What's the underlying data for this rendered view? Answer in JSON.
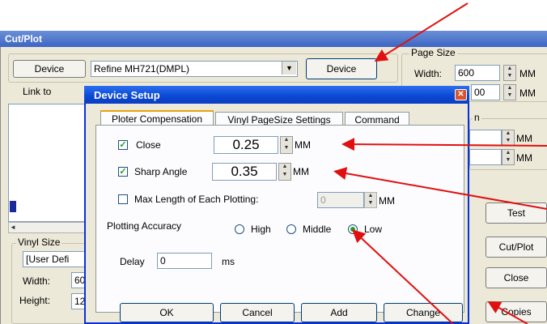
{
  "main_window": {
    "title": "Cut/Plot",
    "device_button": "Device",
    "device_select": "Refine MH721(DMPL)",
    "device_button_2": "Device",
    "link_to_label": "Link to",
    "page_size": {
      "label": "Page Size",
      "width_label": "Width:",
      "width_value": "600",
      "height_value": "00",
      "unit": "MM"
    },
    "right_group": {
      "label": "n",
      "unit_1": "MM",
      "unit_2": "MM"
    },
    "vinyl_size": {
      "label": "Vinyl Size",
      "select_value": "[User Defi",
      "width_label": "Width:",
      "width_value": "60",
      "height_label": "Height:",
      "height_value": "12"
    },
    "buttons": {
      "test": "Test",
      "cut_plot": "Cut/Plot",
      "close": "Close",
      "copies": "Copies"
    }
  },
  "dialog": {
    "title": "Device Setup",
    "tabs": [
      "Ploter Compensation",
      "Vinyl PageSize Settings",
      "Command"
    ],
    "close_row": {
      "label": "Close",
      "value": "0.25",
      "unit": "MM",
      "checked": true
    },
    "sharp_angle_row": {
      "label": "Sharp Angle",
      "value": "0.35",
      "unit": "MM",
      "checked": true
    },
    "max_length_row": {
      "label": "Max Length of Each Plotting:",
      "value": "0",
      "unit": "MM",
      "checked": false
    },
    "accuracy": {
      "label": "Plotting Accuracy",
      "options": [
        "High",
        "Middle",
        "Low"
      ],
      "selected": "Low"
    },
    "delay": {
      "label": "Delay",
      "value": "0",
      "unit": "ms"
    },
    "buttons": {
      "ok": "OK",
      "cancel": "Cancel",
      "add": "Add",
      "change": "Change"
    }
  },
  "colors": {
    "annotation_arrow": "#e01010",
    "dialog_title": "#0a47d2",
    "window_bg": "#ece9d8"
  }
}
